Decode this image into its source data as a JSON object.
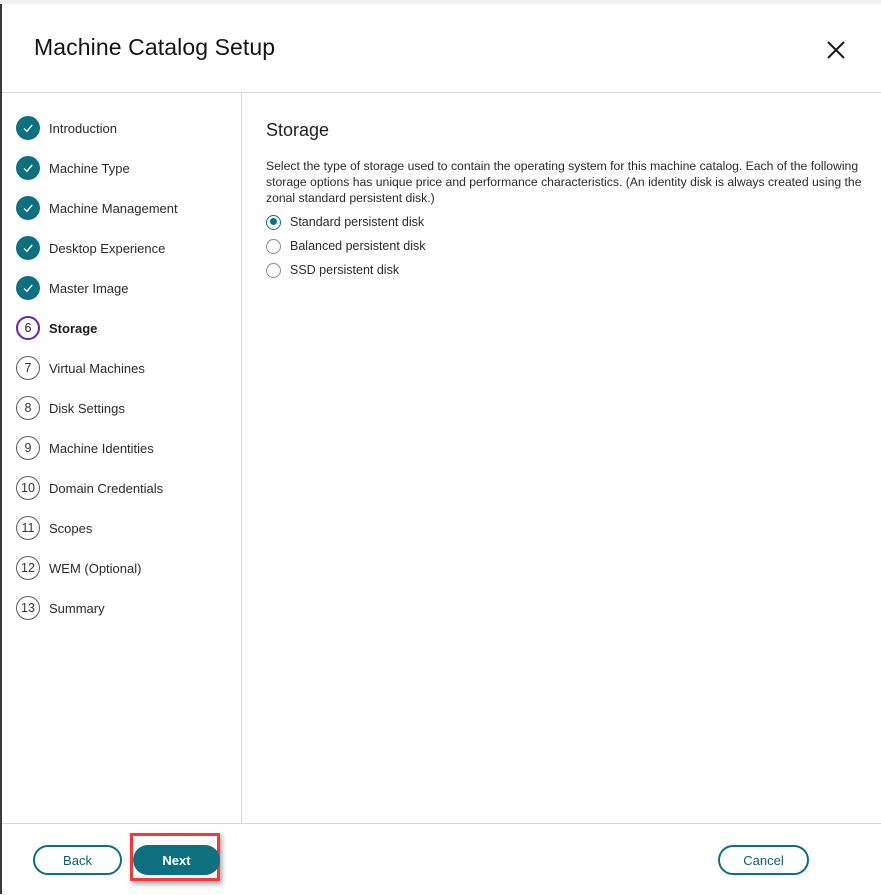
{
  "window": {
    "title": "Machine Catalog Setup",
    "close_icon": "close-x-icon"
  },
  "sidebar": {
    "steps": [
      {
        "number": "1",
        "label": "Introduction",
        "state": "done",
        "icon": "check-icon"
      },
      {
        "number": "2",
        "label": "Machine Type",
        "state": "done",
        "icon": "check-icon"
      },
      {
        "number": "3",
        "label": "Machine Management",
        "state": "done",
        "icon": "check-icon"
      },
      {
        "number": "4",
        "label": "Desktop Experience",
        "state": "done",
        "icon": "check-icon"
      },
      {
        "number": "5",
        "label": "Master Image",
        "state": "done",
        "icon": "check-icon"
      },
      {
        "number": "6",
        "label": "Storage",
        "state": "current"
      },
      {
        "number": "7",
        "label": "Virtual Machines",
        "state": "todo"
      },
      {
        "number": "8",
        "label": "Disk Settings",
        "state": "todo"
      },
      {
        "number": "9",
        "label": "Machine Identities",
        "state": "todo"
      },
      {
        "number": "10",
        "label": "Domain Credentials",
        "state": "todo"
      },
      {
        "number": "11",
        "label": "Scopes",
        "state": "todo"
      },
      {
        "number": "12",
        "label": "WEM (Optional)",
        "state": "todo"
      },
      {
        "number": "13",
        "label": "Summary",
        "state": "todo"
      }
    ]
  },
  "main": {
    "section_title": "Storage",
    "description": "Select the type of storage used to contain the operating system for this machine catalog. Each of the following storage options has unique price and performance characteristics. (An identity disk is always created using the zonal standard persistent disk.)",
    "storage_options": [
      {
        "label": "Standard persistent disk",
        "checked": true
      },
      {
        "label": "Balanced persistent disk",
        "checked": false
      },
      {
        "label": "SSD persistent disk",
        "checked": false
      }
    ]
  },
  "footer": {
    "back_label": "Back",
    "next_label": "Next",
    "cancel_label": "Cancel"
  },
  "colors": {
    "accent": "#0d7080",
    "current_step": "#6a1fb5",
    "highlight": "#ef3b3b"
  }
}
